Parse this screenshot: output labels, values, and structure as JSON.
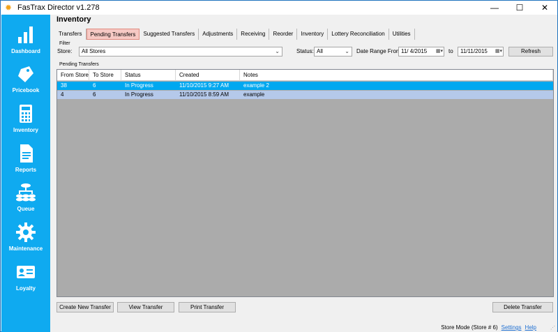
{
  "window": {
    "title": "FasTrax Director v1.278",
    "controls": [
      "—",
      "☐",
      "✕"
    ]
  },
  "sidebar": {
    "items": [
      {
        "label": "Dashboard",
        "icon": "bar-chart-icon"
      },
      {
        "label": "Pricebook",
        "icon": "price-tag-icon"
      },
      {
        "label": "Inventory",
        "icon": "calculator-icon"
      },
      {
        "label": "Reports",
        "icon": "document-icon"
      },
      {
        "label": "Queue",
        "icon": "queue-icon"
      },
      {
        "label": "Maintenance",
        "icon": "gear-icon"
      },
      {
        "label": "Loyalty",
        "icon": "id-card-icon"
      }
    ]
  },
  "page": {
    "title": "Inventory",
    "tabs": [
      {
        "label": "Transfers",
        "active": false
      },
      {
        "label": "Pending Transfers",
        "active": true
      },
      {
        "label": "Suggested Transfers",
        "active": false
      },
      {
        "label": "Adjustments",
        "active": false
      },
      {
        "label": "Receiving",
        "active": false
      },
      {
        "label": "Reorder",
        "active": false
      },
      {
        "label": "Inventory",
        "active": false
      },
      {
        "label": "Lottery Reconciliation",
        "active": false
      },
      {
        "label": "Utilities",
        "active": false
      }
    ]
  },
  "filter": {
    "group_label": "Filter",
    "store_label": "Store:",
    "store_value": "All Stores",
    "status_label": "Status:",
    "status_value": "All",
    "date_range_label": "Date Range From:",
    "date_from": "11/  4/2015",
    "to_label": "to",
    "date_to": "11/11/2015",
    "refresh_label": "Refresh"
  },
  "pending": {
    "group_label": "Pending Transfers",
    "columns": [
      "From Store",
      "To Store",
      "Status",
      "Created",
      "Notes"
    ],
    "rows": [
      {
        "from_store": "38",
        "to_store": "6",
        "status": "In Progress",
        "created": "11/10/2015 9:27 AM",
        "notes": "example 2",
        "selected": true
      },
      {
        "from_store": "4",
        "to_store": "6",
        "status": "In Progress",
        "created": "11/10/2015 8:59 AM",
        "notes": "example",
        "selected": false
      }
    ]
  },
  "actions": {
    "create": "Create New Transfer",
    "view": "View Transfer",
    "print": "Print Transfer",
    "delete": "Delete Transfer"
  },
  "status_bar": {
    "mode": "Store Mode (Store # 6)",
    "settings": "Settings",
    "help": "Help"
  },
  "colors": {
    "sidebar": "#0faaf0",
    "selected_row": "#00a8f0",
    "row": "#b5c9ea",
    "active_tab": "#f6c9c4"
  }
}
